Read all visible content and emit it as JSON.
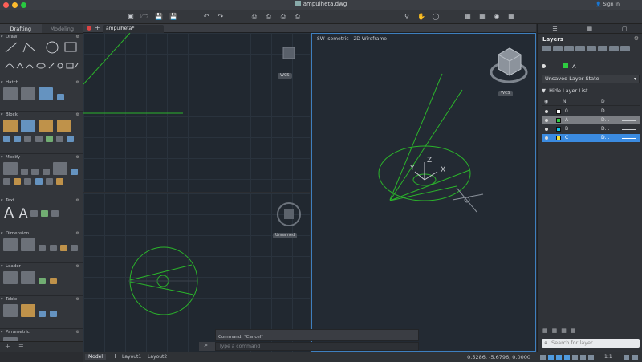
{
  "window": {
    "title": "ampulheta.dwg",
    "sign_in": "Sign In",
    "traffic_lights": [
      "#fe5f57",
      "#febc2e",
      "#28c840"
    ]
  },
  "toolbar": {
    "icons": [
      "new-icon",
      "open-icon",
      "save-icon",
      "save-as-icon",
      "undo-icon",
      "redo-icon",
      "print-icon",
      "plot-icon",
      "publish-icon",
      "export-icon",
      "zoom-icon",
      "pan-icon",
      "orbit-icon",
      "match-properties-icon",
      "layer-icon",
      "render-icon",
      "share-icon"
    ]
  },
  "left_panel": {
    "tabs": [
      "Drafting",
      "Modeling"
    ],
    "active_tab": "Drafting",
    "sections": [
      "Draw",
      "Hatch",
      "Block",
      "Modify",
      "Text",
      "Dimension",
      "Leader",
      "Table",
      "Parametric"
    ]
  },
  "drawing_tabs": {
    "active": "ampulheta*"
  },
  "viewports": {
    "top_left_chip": "WCS",
    "bottom_left_chip": "Unnamed",
    "right_label": "SW Isometric | 2D Wireframe",
    "right_chip": "WCS",
    "axis_labels": [
      "Y",
      "Z",
      "X"
    ]
  },
  "right_panel": {
    "title": "Layers",
    "current_layer": "A",
    "layer_state": "Unsaved Layer State",
    "hide_list": "Hide Layer List",
    "columns": [
      "N",
      "D"
    ],
    "layers": [
      {
        "name": "0",
        "desc": "D...",
        "color": "#ffffff",
        "selected": false
      },
      {
        "name": "A",
        "desc": "D...",
        "color": "#2ecc40",
        "selected": false,
        "highlight": true
      },
      {
        "name": "B",
        "desc": "D...",
        "color": "#12c6ef",
        "selected": false
      },
      {
        "name": "C",
        "desc": "D...",
        "color": "#f1e03c",
        "selected": true
      }
    ],
    "search_placeholder": "Search for layer",
    "selected_row_color": "#3b8be0"
  },
  "command": {
    "history": "Command: *Cancel*",
    "placeholder": "Type a command",
    "prompt": ">_"
  },
  "status": {
    "tabs": [
      "Model",
      "Layout1",
      "Layout2"
    ],
    "active_tab": "Model",
    "coords": "0.5286, -5.6796, 0.0000",
    "scale": "1:1"
  },
  "colors": {
    "drawing_green": "#2bb52b",
    "viewport_bg": "#212830",
    "active_border": "#3e7fbf"
  }
}
